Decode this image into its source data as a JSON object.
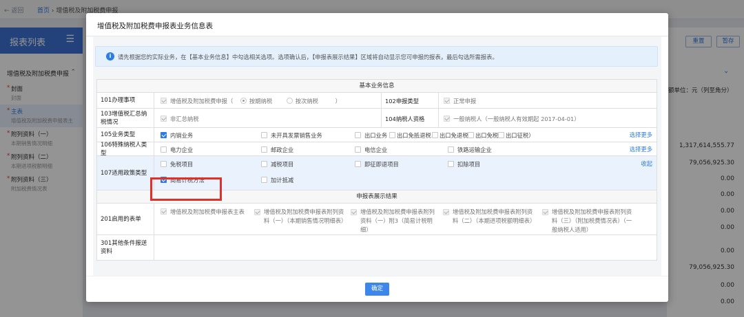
{
  "background": {
    "back_label": "← 返回",
    "breadcrumb_home": "首页",
    "breadcrumb_current": " › 增值税及附加税费申报",
    "sidebar_title": "报表列表",
    "sidebar_group": "增值税及附加税费申报",
    "sidebar_items": [
      {
        "main": "封面",
        "sub": "封面"
      },
      {
        "main": "主表",
        "sub": "增值税及附加税费申报表主"
      },
      {
        "main": "附列资料（一）",
        "sub": "本期销售情况明细"
      },
      {
        "main": "附列资料（二）",
        "sub": "本期进项税额明细"
      },
      {
        "main": "附列资料（三）",
        "sub": "附加税费情况表"
      }
    ],
    "right_buttons": [
      "重置",
      "暂存"
    ],
    "unit_label": "额单位：元（列至角分）",
    "values": [
      "1,317,614,555.77",
      "79,056,925.30",
      "0.00",
      "0.00",
      "0.00",
      "0.00",
      "0.00",
      "79,056,925.30",
      "0.00",
      "0.00"
    ]
  },
  "modal": {
    "title": "增值税及附加税费申报表业务信息表",
    "notice": "请先根据您的实际业务，在【基本业务信息】中勾选相关选项。选项确认后，【申报表展示结果】区域将自动显示您可申报的报表，最后勾选所需报表。",
    "section_basic": "基本业务信息",
    "section_result": "申报表展示结果",
    "row101": {
      "label": "101办理事项",
      "value_prefix": "增值税及附加税费申报（",
      "radio1": "按期纳税",
      "radio2": "按次纳税",
      "value_suffix": "）"
    },
    "row102": {
      "label": "102申报类型",
      "value": "正常申报"
    },
    "row103": {
      "label": "103增值税汇总纳税情况",
      "value": "非汇总纳税"
    },
    "row104": {
      "label": "104纳税人资格",
      "value": "一般纳税人（一般纳税人有效期起 2017-04-01）"
    },
    "row105": {
      "label": "105业务类型",
      "items": [
        "内销业务",
        "未开具发票销售业务",
        "出口业务（",
        "出口免抵退税",
        "出口免退税",
        "出口免税",
        "出口征税）"
      ],
      "more": "选择更多"
    },
    "row106": {
      "label": "106特殊纳税人类型",
      "items": [
        "电力企业",
        "邮政企业",
        "电信企业",
        "铁路运输企业"
      ],
      "more": "选择更多"
    },
    "row107": {
      "label": "107适用政策类型",
      "items": [
        "免税项目",
        "减税项目",
        "即征即退项目",
        "扣除项目",
        "简易计税方法",
        "加计抵减"
      ],
      "collapse": "收起"
    },
    "row201": {
      "label": "201启用的表单",
      "items": [
        "增值税及附加税费申报表主表",
        "增值税及附加税费申报表附列资料（一）（本期销售情况明细表）",
        "增值税及附加税费申报表附列资料（一）附3（简易计税明细）",
        "增值税及附加税费申报表附列资料（二）（本期进项税额明细表）",
        "增值税及附加税费申报表附列资料（三）（附加税费情况表）（一般纳税人适用）"
      ]
    },
    "row301": {
      "label": "301其他条件报送资料"
    },
    "confirm_label": "确定"
  }
}
